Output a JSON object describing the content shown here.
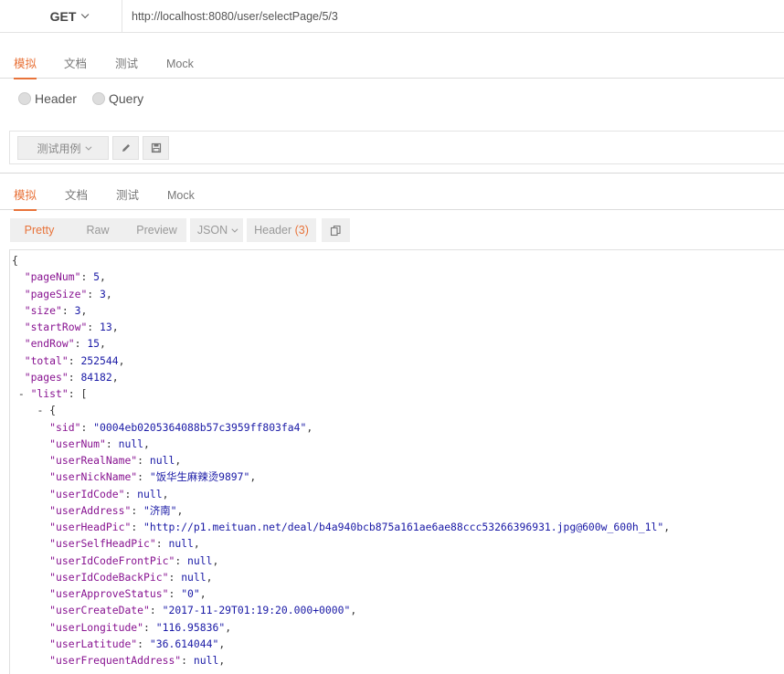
{
  "request": {
    "method": "GET",
    "url": "http://localhost:8080/user/selectPage/5/3"
  },
  "request_tabs": [
    "模拟",
    "文档",
    "测试",
    "Mock"
  ],
  "param_types": [
    "Header",
    "Query"
  ],
  "test_toolbar": {
    "test_case_label": "测试用例",
    "edit_icon": "pencil-icon",
    "save_icon": "save-icon"
  },
  "response_tabs": [
    "模拟",
    "文档",
    "测试",
    "Mock"
  ],
  "response_toolbar": {
    "pretty": "Pretty",
    "raw": "Raw",
    "preview": "Preview",
    "format": "JSON",
    "header": "Header",
    "header_count": "(3)",
    "copy_icon": "copy-icon"
  },
  "colors": {
    "accent": "#e8733a",
    "json_key": "#881391",
    "json_value": "#1a1aa6"
  },
  "json_lines": [
    {
      "indent": 0,
      "toggle": "",
      "key": "",
      "value": "",
      "punct": "{"
    },
    {
      "indent": 2,
      "toggle": "",
      "key": "\"pageNum\"",
      "value": "5",
      "punct": ","
    },
    {
      "indent": 2,
      "toggle": "",
      "key": "\"pageSize\"",
      "value": "3",
      "punct": ","
    },
    {
      "indent": 2,
      "toggle": "",
      "key": "\"size\"",
      "value": "3",
      "punct": ","
    },
    {
      "indent": 2,
      "toggle": "",
      "key": "\"startRow\"",
      "value": "13",
      "punct": ","
    },
    {
      "indent": 2,
      "toggle": "",
      "key": "\"endRow\"",
      "value": "15",
      "punct": ","
    },
    {
      "indent": 2,
      "toggle": "",
      "key": "\"total\"",
      "value": "252544",
      "punct": ","
    },
    {
      "indent": 2,
      "toggle": "",
      "key": "\"pages\"",
      "value": "84182",
      "punct": ","
    },
    {
      "indent": 1,
      "toggle": "- ",
      "key": "\"list\"",
      "value": "",
      "punct": "["
    },
    {
      "indent": 4,
      "toggle": "- ",
      "key": "",
      "value": "",
      "punct": "{"
    },
    {
      "indent": 6,
      "toggle": "",
      "key": "\"sid\"",
      "value": "\"0004eb0205364088b57c3959ff803fa4\"",
      "punct": ","
    },
    {
      "indent": 6,
      "toggle": "",
      "key": "\"userNum\"",
      "value": "null",
      "punct": ","
    },
    {
      "indent": 6,
      "toggle": "",
      "key": "\"userRealName\"",
      "value": "null",
      "punct": ","
    },
    {
      "indent": 6,
      "toggle": "",
      "key": "\"userNickName\"",
      "value": "\"饭华生麻辣烫9897\"",
      "punct": ","
    },
    {
      "indent": 6,
      "toggle": "",
      "key": "\"userIdCode\"",
      "value": "null",
      "punct": ","
    },
    {
      "indent": 6,
      "toggle": "",
      "key": "\"userAddress\"",
      "value": "\"济南\"",
      "punct": ","
    },
    {
      "indent": 6,
      "toggle": "",
      "key": "\"userHeadPic\"",
      "value": "\"http://p1.meituan.net/deal/b4a940bcb875a161ae6ae88ccc53266396931.jpg@600w_600h_1l\"",
      "punct": ","
    },
    {
      "indent": 6,
      "toggle": "",
      "key": "\"userSelfHeadPic\"",
      "value": "null",
      "punct": ","
    },
    {
      "indent": 6,
      "toggle": "",
      "key": "\"userIdCodeFrontPic\"",
      "value": "null",
      "punct": ","
    },
    {
      "indent": 6,
      "toggle": "",
      "key": "\"userIdCodeBackPic\"",
      "value": "null",
      "punct": ","
    },
    {
      "indent": 6,
      "toggle": "",
      "key": "\"userApproveStatus\"",
      "value": "\"0\"",
      "punct": ","
    },
    {
      "indent": 6,
      "toggle": "",
      "key": "\"userCreateDate\"",
      "value": "\"2017-11-29T01:19:20.000+0000\"",
      "punct": ","
    },
    {
      "indent": 6,
      "toggle": "",
      "key": "\"userLongitude\"",
      "value": "\"116.95836\"",
      "punct": ","
    },
    {
      "indent": 6,
      "toggle": "",
      "key": "\"userLatitude\"",
      "value": "\"36.614044\"",
      "punct": ","
    },
    {
      "indent": 6,
      "toggle": "",
      "key": "\"userFrequentAddress\"",
      "value": "null",
      "punct": ","
    }
  ]
}
